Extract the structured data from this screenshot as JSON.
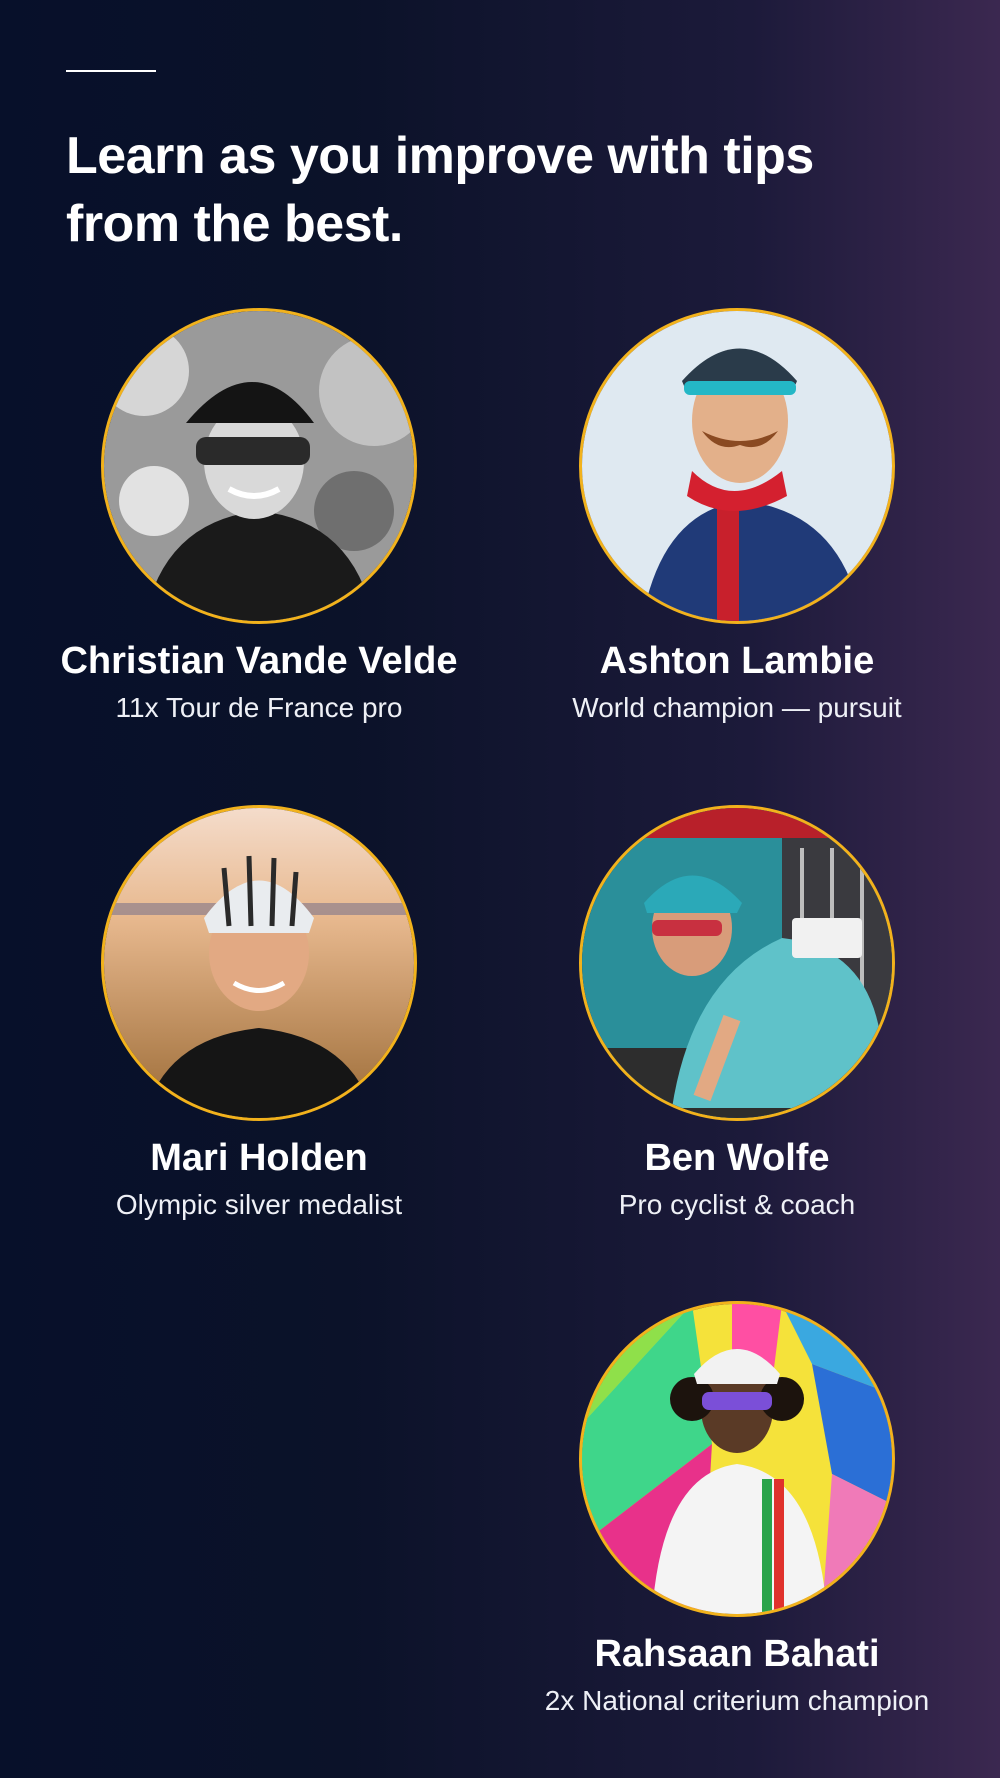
{
  "headline": "Learn as you improve with tips from the best.",
  "colors": {
    "background_start": "#07102a",
    "background_end": "#3b2850",
    "avatar_ring": "#f2b21c",
    "text": "#ffffff"
  },
  "coaches": [
    {
      "name": "Christian Vande Velde",
      "role": "11x Tour de France pro"
    },
    {
      "name": "Ashton Lambie",
      "role": "World champion — pursuit"
    },
    {
      "name": "Mari Holden",
      "role": "Olympic silver medalist"
    },
    {
      "name": "Ben Wolfe",
      "role": "Pro cyclist & coach"
    },
    {
      "name": "Rahsaan Bahati",
      "role": "2x National criterium champion"
    }
  ]
}
